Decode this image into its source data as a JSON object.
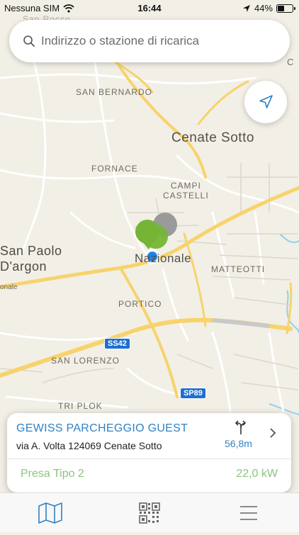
{
  "status_bar": {
    "carrier": "Nessuna SIM",
    "time": "16:44",
    "battery": "44%",
    "battery_level": 0.44,
    "icons": [
      "wifi-icon",
      "location-arrow-icon",
      "battery-icon"
    ]
  },
  "search": {
    "placeholder": "Indirizzo o stazione di ricarica",
    "icon": "search-icon"
  },
  "locate_button": {
    "icon": "navigation-arrow-icon"
  },
  "map": {
    "labels": {
      "top_partial": "San Rocco",
      "san_bernardo": "SAN BERNARDO",
      "cenate_sotto": "Cenate Sotto",
      "fornace": "FORNACE",
      "campi_castelli": "CAMPI\nCASTELLI",
      "san_paolo": "San Paolo\nD'argon",
      "nazionale": "Nazionale",
      "matteotti": "MATTEOTTI",
      "onale": "onale",
      "portico": "PORTICO",
      "san_lorenzo": "SAN LORENZO",
      "tri_plok": "TRI PLOK",
      "right_edge": "C"
    },
    "road_shields": {
      "ss42": "SS42",
      "sp89": "SP89"
    },
    "colors": {
      "background": "#f2efe6",
      "major_road": "#f7d36b",
      "minor_road": "#ffffff",
      "water": "#8fd0ee",
      "pin_green": "#74b536",
      "pin_gray": "#9a9a9a",
      "user_location": "#1d82e8"
    }
  },
  "station_card": {
    "name": "GEWISS PARCHEGGIO GUEST",
    "address": "via A. Volta 124069 Cenate Sotto",
    "distance": "56,8m",
    "plug_type": "Presa Tipo 2",
    "power": "22,0 kW",
    "colors": {
      "title": "#2f82c4",
      "plug": "#8cc37f"
    }
  },
  "tab_bar": {
    "tabs": [
      {
        "icon": "map-icon",
        "active": true
      },
      {
        "icon": "qr-code-icon",
        "active": false
      },
      {
        "icon": "menu-icon",
        "active": false
      }
    ],
    "active_color": "#2f82c4"
  }
}
